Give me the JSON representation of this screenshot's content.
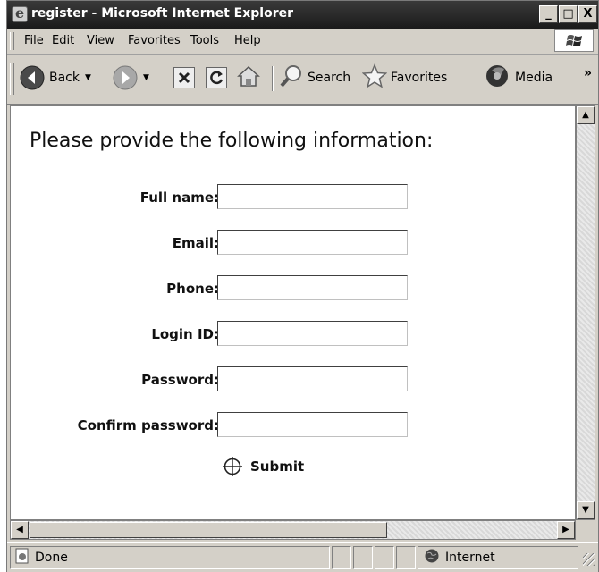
{
  "window": {
    "title": "register - Microsoft Internet Explorer",
    "minimize": "_",
    "maximize": "□",
    "close": "X"
  },
  "menubar": {
    "items": [
      "File",
      "Edit",
      "View",
      "Favorites",
      "Tools",
      "Help"
    ]
  },
  "toolbar": {
    "back_label": "Back",
    "search_label": "Search",
    "favorites_label": "Favorites",
    "media_label": "Media",
    "overflow": "»"
  },
  "form": {
    "heading": "Please provide the following information:",
    "fields": [
      {
        "label": "Full name:",
        "value": ""
      },
      {
        "label": "Email:",
        "value": ""
      },
      {
        "label": "Phone:",
        "value": ""
      },
      {
        "label": "Login ID:",
        "value": ""
      },
      {
        "label": "Password:",
        "value": ""
      },
      {
        "label": "Confirm password:",
        "value": ""
      }
    ],
    "submit_label": "Submit"
  },
  "statusbar": {
    "status_text": "Done",
    "zone_text": "Internet"
  },
  "icons": {
    "app": "ie-icon",
    "back": "back-arrow-icon",
    "forward": "forward-arrow-icon",
    "stop": "stop-icon",
    "refresh": "refresh-icon",
    "home": "home-icon",
    "search": "magnifier-icon",
    "favorites": "star-icon",
    "media": "media-icon",
    "submit": "crosshair-icon",
    "zone": "globe-icon"
  }
}
